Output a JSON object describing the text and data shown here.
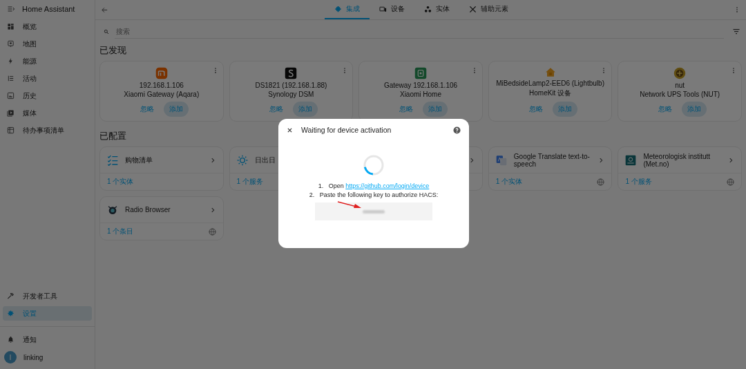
{
  "sidebar": {
    "title": "Home Assistant",
    "items": [
      {
        "label": "概览",
        "selected": false
      },
      {
        "label": "地图",
        "selected": false
      },
      {
        "label": "能源",
        "selected": false
      },
      {
        "label": "活动",
        "selected": false
      },
      {
        "label": "历史",
        "selected": false
      },
      {
        "label": "媒体",
        "selected": false
      },
      {
        "label": "待办事项清单",
        "selected": false
      }
    ],
    "bottom_items": [
      {
        "label": "开发者工具",
        "selected": false
      },
      {
        "label": "设置",
        "selected": true
      }
    ],
    "notifications": "通知",
    "user": {
      "initial": "l",
      "name": "linking"
    }
  },
  "tabs": [
    {
      "label": "集成",
      "selected": true
    },
    {
      "label": "设备",
      "selected": false
    },
    {
      "label": "实体",
      "selected": false
    },
    {
      "label": "辅助元素",
      "selected": false
    }
  ],
  "search": {
    "placeholder": "搜索"
  },
  "discovered": {
    "heading": "已发现",
    "cards": [
      {
        "title": "192.168.1.106",
        "subtitle": "Xiaomi Gateway (Aqara)",
        "ignore": "忽略",
        "add": "添加"
      },
      {
        "title": "DS1821 (192.168.1.88)",
        "subtitle": "Synology DSM",
        "ignore": "忽略",
        "add": "添加"
      },
      {
        "title": "Gateway 192.168.1.106",
        "subtitle": "Xiaomi Home",
        "ignore": "忽略",
        "add": "添加"
      },
      {
        "title": "MiBedsideLamp2-EED6 (Lightbulb)",
        "subtitle": "HomeKit 设备",
        "ignore": "忽略",
        "add": "添加"
      },
      {
        "title": "nut",
        "subtitle": "Network UPS Tools (NUT)",
        "ignore": "忽略",
        "add": "添加"
      }
    ]
  },
  "configured": {
    "heading": "已配置",
    "cards": [
      {
        "kind": "card",
        "title": "购物清单",
        "footer": "1 个实体",
        "cloud": false
      },
      {
        "kind": "partial",
        "title": "日出日",
        "footer": "1 个服务"
      },
      {
        "kind": "covered"
      },
      {
        "kind": "card",
        "title": "Google Translate text-to-speech",
        "footer": "1 个实体",
        "cloud": true
      },
      {
        "kind": "card",
        "title": "Meteorologisk institutt (Met.no)",
        "footer": "1 个服务",
        "cloud": true
      },
      {
        "kind": "card",
        "title": "Radio Browser",
        "footer": "1 个条目",
        "cloud": true
      }
    ]
  },
  "dialog": {
    "title": "Waiting for device activation",
    "steps": [
      {
        "number": "1.",
        "text": "Open ",
        "link": "https://github.com/login/device"
      },
      {
        "number": "2.",
        "text": "Paste the following key to authorize HACS:"
      }
    ],
    "spinner": {
      "level": 0.2
    }
  }
}
